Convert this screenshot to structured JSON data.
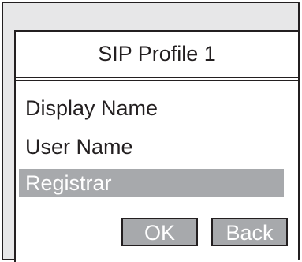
{
  "screen": {
    "title": "SIP Profile 1"
  },
  "menu": {
    "items": [
      {
        "label": "Display Name",
        "selected": false
      },
      {
        "label": "User Name",
        "selected": false
      },
      {
        "label": "Registrar",
        "selected": true
      }
    ]
  },
  "softkeys": {
    "ok_label": "OK",
    "back_label": "Back"
  },
  "colors": {
    "frame": "#e7e7e8",
    "outline": "#231f20",
    "highlight": "#a7a9ac",
    "highlight_text": "#ffffff"
  }
}
